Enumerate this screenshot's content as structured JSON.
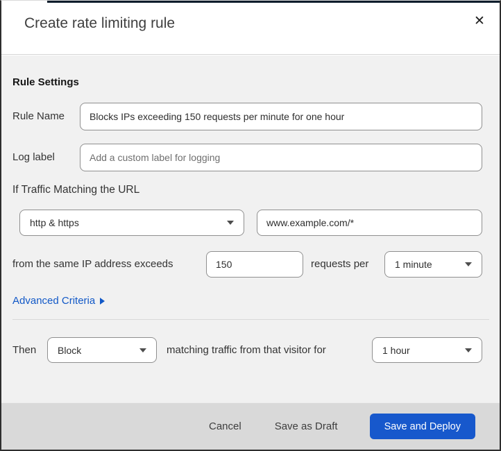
{
  "dialog": {
    "title": "Create rate limiting rule"
  },
  "icons": {
    "close": "✕",
    "dropdown_caret": "caret-down-triangle",
    "advanced_caret": "caret-right-triangle"
  },
  "colors": {
    "primary_button_blue": "#1758CC",
    "link_blue": "#1158C7",
    "top_sliver_navy": "#0C1C2B",
    "body_background": "#F1F1F1",
    "footer_background": "#D9D9D9"
  },
  "rule_settings": {
    "heading": "Rule Settings",
    "rule_name": {
      "label": "Rule Name",
      "value": "Blocks IPs exceeding 150 requests per minute for one hour"
    },
    "log_label": {
      "label": "Log label",
      "placeholder": "Add a custom label for logging"
    }
  },
  "criteria": {
    "intro": "If Traffic Matching the URL",
    "scheme_select": {
      "value": "http & https"
    },
    "url_input": {
      "value": "www.example.com/*"
    },
    "threshold_text_before": "from the same IP address exceeds",
    "threshold_input": {
      "value": "150"
    },
    "threshold_text_after": "requests per",
    "period_select": {
      "value": "1 minute"
    },
    "advanced_link": "Advanced Criteria"
  },
  "action": {
    "then_label": "Then",
    "action_select": {
      "value": "Block"
    },
    "middle_text": "matching traffic from that visitor for",
    "duration_select": {
      "value": "1 hour"
    }
  },
  "footer": {
    "cancel": "Cancel",
    "save_draft": "Save as Draft",
    "save_deploy": "Save and Deploy"
  }
}
